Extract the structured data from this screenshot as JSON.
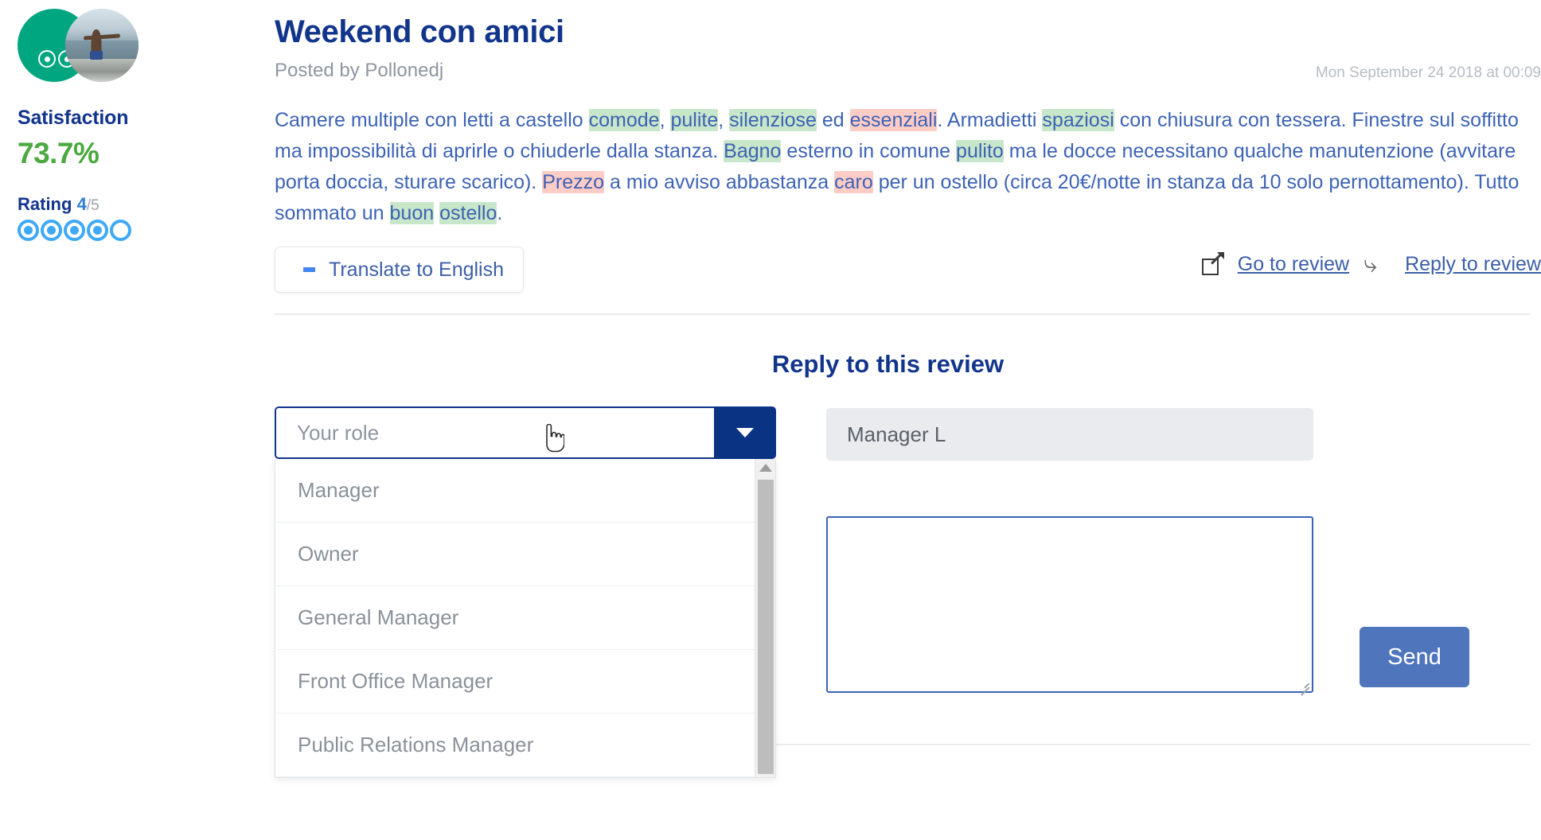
{
  "sidebar": {
    "source_icon": "tripadvisor-owl-icon",
    "avatar_alt": "user-avatar-photo",
    "satisfaction_label": "Satisfaction",
    "satisfaction_value": "73.7%",
    "satisfaction_color": "#4aa93f",
    "rating_label": "Rating",
    "rating_value": "4",
    "rating_out_of": "/5",
    "rating_filled": 4,
    "rating_total": 5,
    "bubble_color": "#3fa9f5"
  },
  "review": {
    "title": "Weekend con amici",
    "byline": "Posted by Pollonedj",
    "date": "Mon September 24 2018 at 00:09",
    "body_segments": [
      {
        "text": "Camere multiple con letti a castello ",
        "highlight": "none"
      },
      {
        "text": "comode",
        "highlight": "positive"
      },
      {
        "text": ", ",
        "highlight": "none"
      },
      {
        "text": "pulite",
        "highlight": "positive"
      },
      {
        "text": ", ",
        "highlight": "none"
      },
      {
        "text": "silenziose",
        "highlight": "positive"
      },
      {
        "text": " ed ",
        "highlight": "none"
      },
      {
        "text": "essenziali",
        "highlight": "negative"
      },
      {
        "text": ". Armadietti ",
        "highlight": "none"
      },
      {
        "text": "spaziosi",
        "highlight": "positive"
      },
      {
        "text": " con chiusura con tessera. Finestre sul soffitto ma impossibilità di aprirle o chiuderle dalla stanza. ",
        "highlight": "none"
      },
      {
        "text": "Bagno",
        "highlight": "positive"
      },
      {
        "text": " esterno in comune ",
        "highlight": "none"
      },
      {
        "text": "pulito",
        "highlight": "positive"
      },
      {
        "text": " ma le docce necessitano qualche manutenzione (avvitare porta doccia, sturare scarico). ",
        "highlight": "none"
      },
      {
        "text": "Prezzo",
        "highlight": "negative"
      },
      {
        "text": " a mio avviso abbastanza ",
        "highlight": "none"
      },
      {
        "text": "caro",
        "highlight": "negative"
      },
      {
        "text": " per un ostello (circa 20€/notte in stanza da 10 solo pernottamento). Tutto sommato un ",
        "highlight": "none"
      },
      {
        "text": "buon",
        "highlight": "positive"
      },
      {
        "text": " ",
        "highlight": "none"
      },
      {
        "text": "ostello",
        "highlight": "positive"
      },
      {
        "text": ".",
        "highlight": "none"
      }
    ],
    "highlight_positive_color": "#c8e6c9",
    "highlight_negative_color": "#ffccc6",
    "text_color": "#3c63b5"
  },
  "actions": {
    "translate_label": "Translate to English",
    "translate_icon": "google-g-icon",
    "go_to_review_label": "Go to review",
    "go_to_review_icon": "external-link-icon",
    "reply_to_review_label": "Reply to review",
    "reply_icon": "reply-arrow-icon"
  },
  "reply_form": {
    "heading": "Reply to this review",
    "role_placeholder": "Your role",
    "role_value": "",
    "dropdown_open": true,
    "dropdown_options": [
      "Manager",
      "Owner",
      "General Manager",
      "Front Office Manager",
      "Public Relations Manager"
    ],
    "signature_value": "Manager L",
    "message_value": "",
    "message_placeholder": "",
    "send_label": "Send",
    "send_color": "#4f75bd",
    "accent_color": "#0b3383"
  }
}
